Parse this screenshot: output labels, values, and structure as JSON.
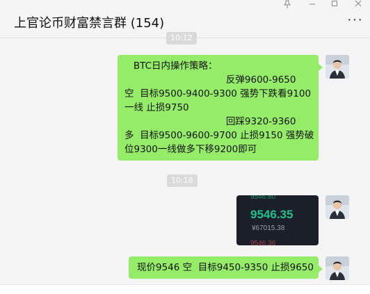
{
  "window": {
    "title": "上官论币财富禁言群 (154)",
    "pin_icon": "pin-icon",
    "minimize_icon": "minimize-icon",
    "maximize_icon": "maximize-icon",
    "close_icon": "close-icon",
    "more_label": "···"
  },
  "messages": {
    "ts1": "10:12",
    "m1_lines": [
      "   BTC日内操作策略：",
      "                                  反弹9600-9650",
      "空  目标9500-9400-9300 强势下跌看9100",
      "一线 止损9750",
      "                                  回踩9320-9360",
      "多  目标9500-9600-9700 止损9150 强势破",
      "位9300一线做多下移9200即可"
    ],
    "ts2": "10:18",
    "img_top_price": "9546.80",
    "img_price": "9546.35",
    "img_cny": "¥67015.38",
    "img_bottom_price": "9546.36",
    "m3": "现价9546 空  目标9450-9350 止损9650"
  },
  "colors": {
    "bubble": "#95ec69",
    "price_green": "#21c08b"
  }
}
